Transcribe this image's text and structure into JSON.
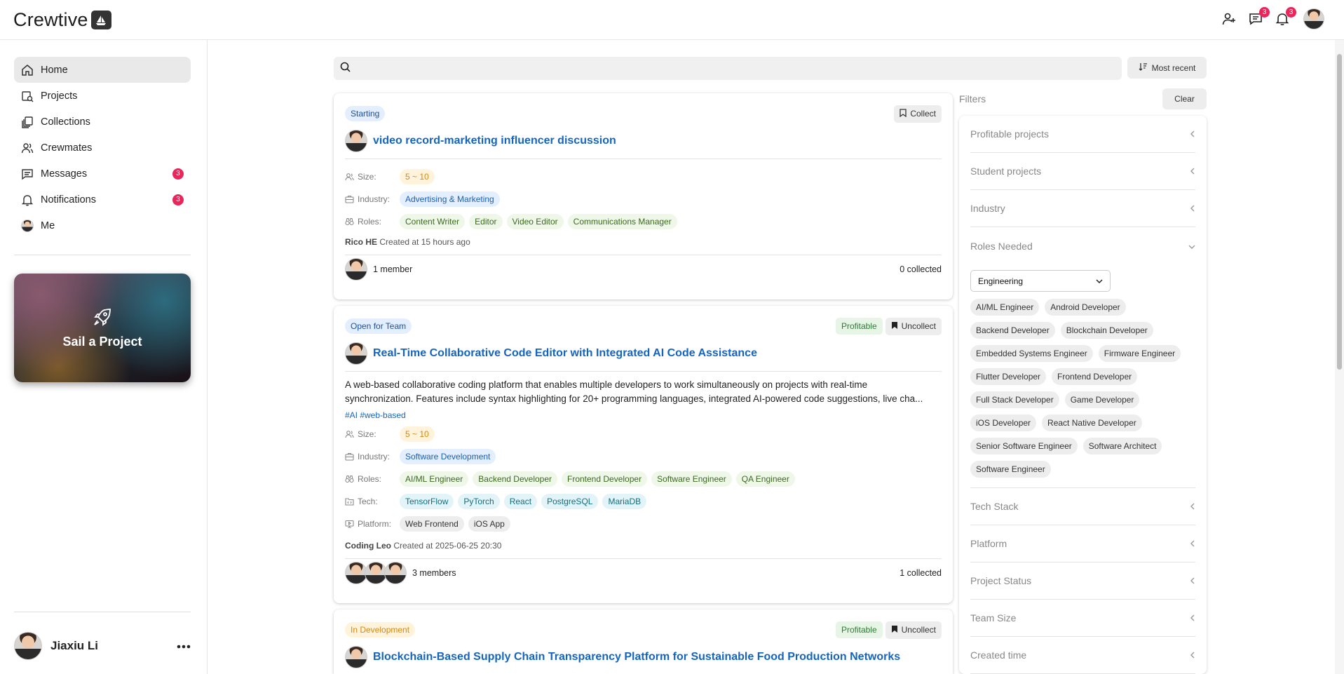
{
  "app": {
    "name": "Crewtive"
  },
  "header": {
    "messages_count": "3",
    "notifications_count": "3"
  },
  "sidebar": {
    "items": [
      {
        "label": "Home"
      },
      {
        "label": "Projects"
      },
      {
        "label": "Collections"
      },
      {
        "label": "Crewmates"
      },
      {
        "label": "Messages",
        "badge": "3"
      },
      {
        "label": "Notifications",
        "badge": "3"
      },
      {
        "label": "Me"
      }
    ],
    "sail_label": "Sail a Project",
    "user_name": "Jiaxiu Li"
  },
  "search": {
    "placeholder": "",
    "sort_label": "Most recent"
  },
  "labels": {
    "size": "Size:",
    "industry": "Industry:",
    "roles": "Roles:",
    "tech": "Tech:",
    "platform": "Platform:"
  },
  "projects": [
    {
      "status": "Starting",
      "collect_label": "Collect",
      "title": "video record-marketing influencer discussion",
      "size": "5 ~ 10",
      "industry": "Advertising & Marketing",
      "roles": [
        "Content Writer",
        "Editor",
        "Video Editor",
        "Communications Manager"
      ],
      "creator": "Rico HE",
      "created": "Created at 15 hours ago",
      "members": "1 member",
      "collected": "0 collected"
    },
    {
      "status": "Open for Team",
      "profitable": "Profitable",
      "collect_label": "Uncollect",
      "title": "Real-Time Collaborative Code Editor with Integrated AI Code Assistance",
      "desc_line1": "A web-based collaborative coding platform that enables multiple developers to work simultaneously on projects with real-time",
      "desc_line2": "synchronization. Features include syntax highlighting for 20+ programming languages, integrated AI-powered code suggestions, live cha...",
      "tags": "#AI #web-based",
      "size": "5 ~ 10",
      "industry": "Software Development",
      "roles": [
        "AI/ML Engineer",
        "Backend Developer",
        "Frontend Developer",
        "Software Engineer",
        "QA Engineer"
      ],
      "tech": [
        "TensorFlow",
        "PyTorch",
        "React",
        "PostgreSQL",
        "MariaDB"
      ],
      "platform": [
        "Web Frontend",
        "iOS App"
      ],
      "creator": "Coding Leo",
      "created": "Created at 2025-06-25 20:30",
      "members": "3 members",
      "collected": "1 collected"
    },
    {
      "status": "In Development",
      "profitable": "Profitable",
      "collect_label": "Uncollect",
      "title": "Blockchain-Based Supply Chain Transparency Platform for Sustainable Food Production Networks"
    }
  ],
  "filters": {
    "title": "Filters",
    "clear_label": "Clear",
    "sections_top": [
      "Profitable projects",
      "Student projects",
      "Industry",
      "Roles Needed"
    ],
    "roles_select": "Engineering",
    "role_options": [
      "AI/ML Engineer",
      "Android Developer",
      "Backend Developer",
      "Blockchain Developer",
      "Embedded Systems Engineer",
      "Firmware Engineer",
      "Flutter Developer",
      "Frontend Developer",
      "Full Stack Developer",
      "Game Developer",
      "iOS Developer",
      "React Native Developer",
      "Senior Software Engineer",
      "Software Architect",
      "Software Engineer"
    ],
    "sections_bottom": [
      "Tech Stack",
      "Platform",
      "Project Status",
      "Team Size",
      "Created time"
    ]
  }
}
